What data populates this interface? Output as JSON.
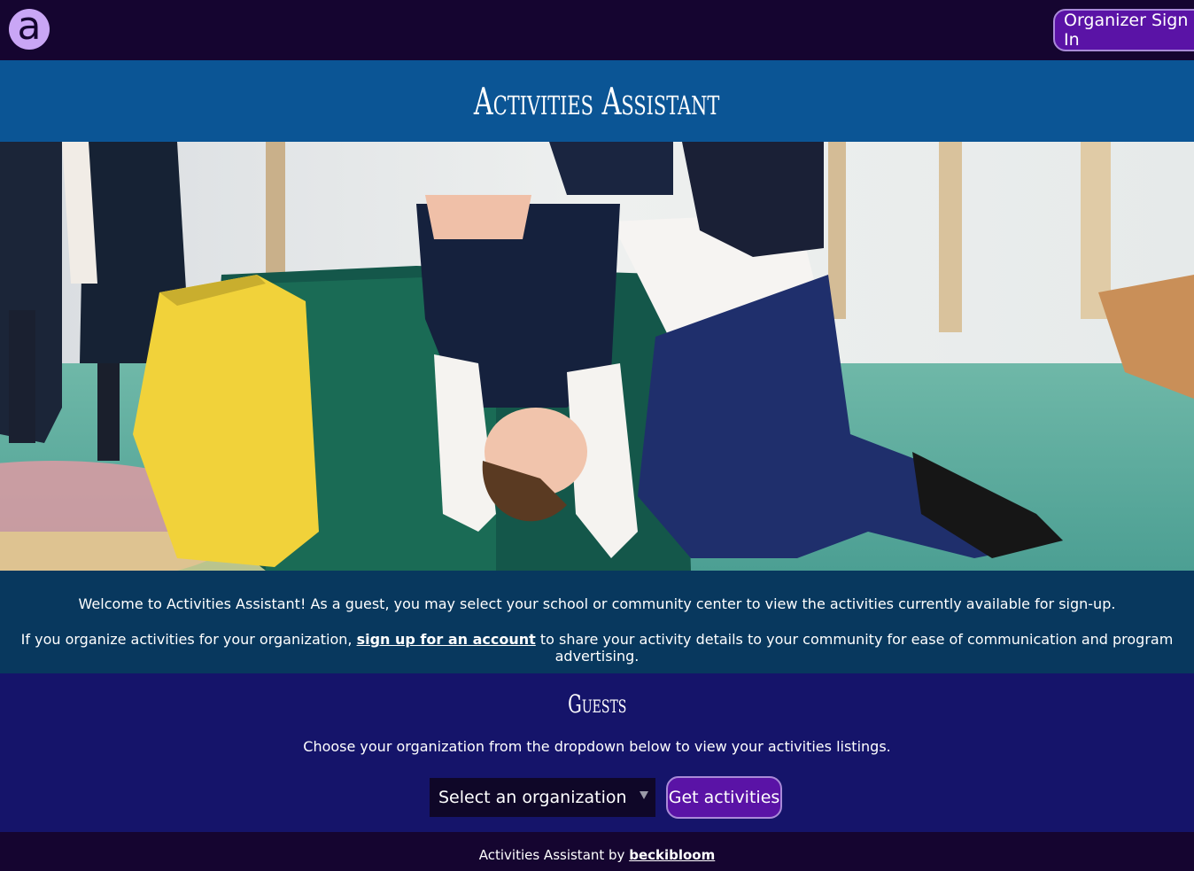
{
  "header": {
    "logo_letter": "a",
    "signin_label": "Organizer Sign In"
  },
  "title": "Activities Assistant",
  "hero": {
    "image_icon": "photo-child-upside-down-gym"
  },
  "welcome": {
    "line1": "Welcome to Activities Assistant! As a guest, you may select your school or community center to view the activities currently available for sign-up.",
    "line2_before": "If you organize activities for your organization, ",
    "line2_link": "sign up for an account",
    "line2_after": " to share your activity details to your community for ease of communication and program advertising."
  },
  "guests": {
    "heading": "Guests",
    "instructions": "Choose your organization from the dropdown below to view your activities listings.",
    "select_value": "Select an organization",
    "button_label": "Get activities"
  },
  "footer": {
    "text": "Activities Assistant by ",
    "link": "beckibloom"
  },
  "colors": {
    "topbar": "#150530",
    "title_band": "#0b5595",
    "welcome_band": "#08385e",
    "guests_band": "#15146a",
    "button": "#5a13a6",
    "logo": "#c9a6f5"
  }
}
